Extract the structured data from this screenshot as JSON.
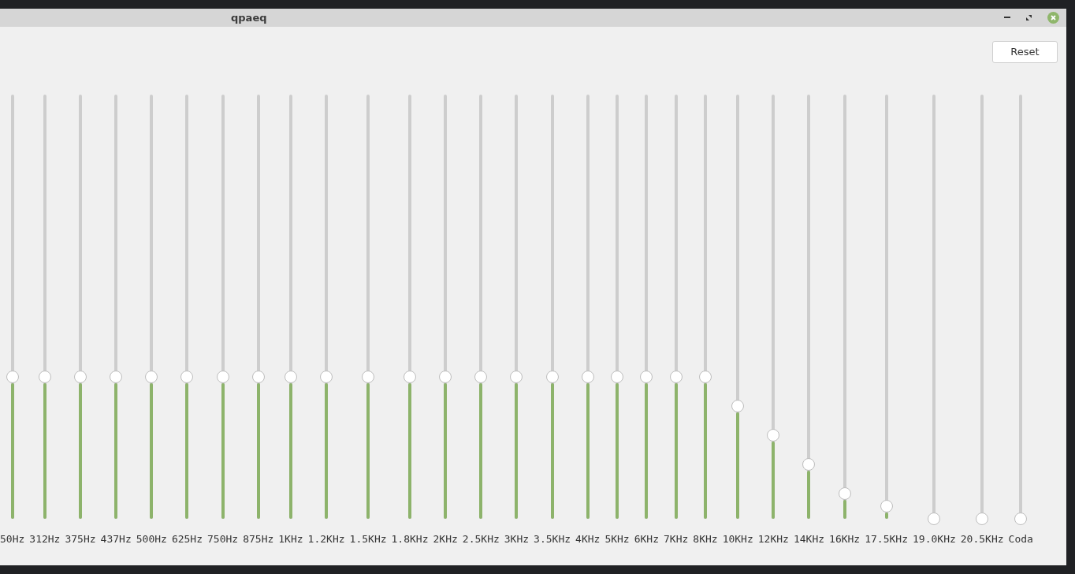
{
  "window": {
    "title": "qpaeq"
  },
  "reset_button": "Reset",
  "bands": [
    {
      "label": "50Hz",
      "level": 0.335
    },
    {
      "label": "312Hz",
      "level": 0.335
    },
    {
      "label": "375Hz",
      "level": 0.335
    },
    {
      "label": "437Hz",
      "level": 0.335
    },
    {
      "label": "500Hz",
      "level": 0.335
    },
    {
      "label": "625Hz",
      "level": 0.335
    },
    {
      "label": "750Hz",
      "level": 0.335
    },
    {
      "label": "875Hz",
      "level": 0.335
    },
    {
      "label": "1KHz",
      "level": 0.335
    },
    {
      "label": "1.2KHz",
      "level": 0.335
    },
    {
      "label": "1.5KHz",
      "level": 0.335
    },
    {
      "label": "1.8KHz",
      "level": 0.335
    },
    {
      "label": "2KHz",
      "level": 0.335
    },
    {
      "label": "2.5KHz",
      "level": 0.335
    },
    {
      "label": "3KHz",
      "level": 0.335
    },
    {
      "label": "3.5KHz",
      "level": 0.335
    },
    {
      "label": "4KHz",
      "level": 0.335
    },
    {
      "label": "5KHz",
      "level": 0.335
    },
    {
      "label": "6KHz",
      "level": 0.335
    },
    {
      "label": "7KHz",
      "level": 0.335
    },
    {
      "label": "8KHz",
      "level": 0.335
    },
    {
      "label": "10KHz",
      "level": 0.266
    },
    {
      "label": "12KHz",
      "level": 0.197
    },
    {
      "label": "14KHz",
      "level": 0.128
    },
    {
      "label": "16KHz",
      "level": 0.059
    },
    {
      "label": "17.5KHz",
      "level": 0.03
    },
    {
      "label": "19.0KHz",
      "level": 0
    },
    {
      "label": "20.5KHz",
      "level": 0
    },
    {
      "label": "Coda",
      "level": 0
    }
  ]
}
